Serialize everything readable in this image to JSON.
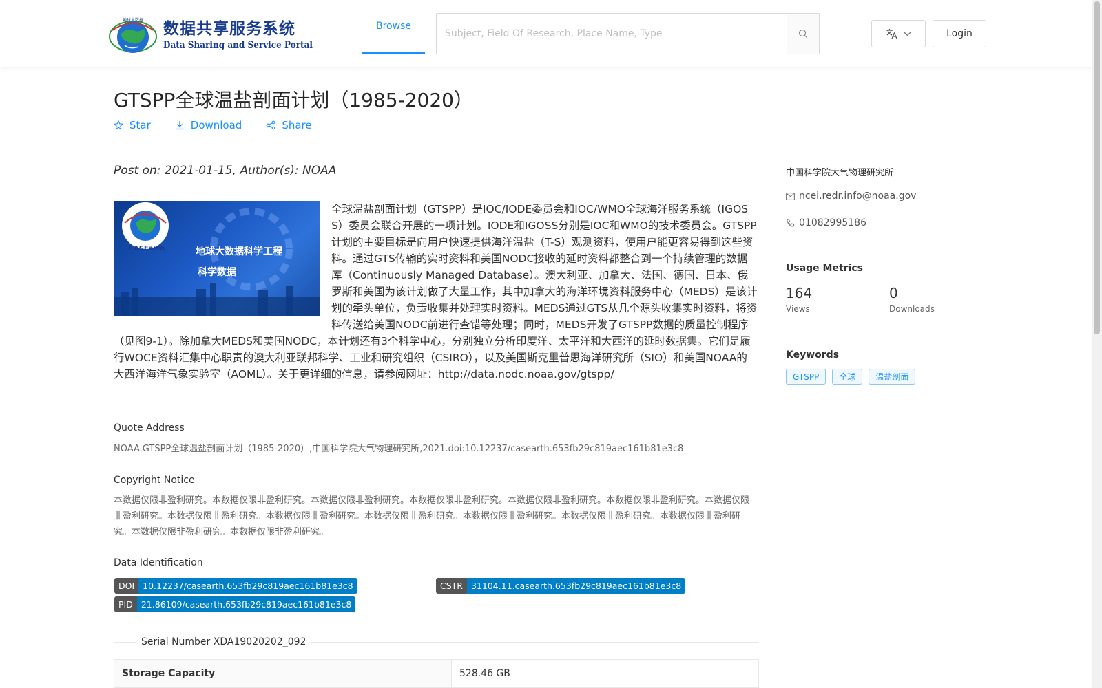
{
  "header": {
    "logo_cn": "数据共享服务系统",
    "logo_en": "Data Sharing and Service Portal",
    "nav_browse": "Browse",
    "search_placeholder": "Subject, Field Of Research, Place Name, Type",
    "login_label": "Login"
  },
  "dataset": {
    "title": "GTSPP全球温盐剖面计划（1985-2020）",
    "actions": {
      "star": "Star",
      "download": "Download",
      "share": "Share"
    },
    "posted": "Post on: 2021-01-15, Author(s): NOAA",
    "image_caption_line1": "地球大数据科学工程",
    "image_caption_line2": "科学数据",
    "image_badge": "CASEarth",
    "description": "全球温盐剖面计划（GTSPP）是IOC/IODE委员会和IOC/WMO全球海洋服务系统（IGOSS）委员会联合开展的一项计划。IODE和IGOSS分别是IOC和WMO的技术委员会。GTSPP计划的主要目标是向用户快速提供海洋温盐（T-S）观测资料，使用户能更容易得到这些资料。通过GTS传输的实时资料和美国NODC接收的延时资料都整合到一个持续管理的数据库（Continuously Managed Database）。澳大利亚、加拿大、法国、德国、日本、俄罗斯和美国为该计划做了大量工作，其中加拿大的海洋环境资料服务中心（MEDS）是该计划的牵头单位，负责收集并处理实时资料。MEDS通过GTS从几个源头收集实时资料，将资料传送给美国NODC前进行查错等处理；同时，MEDS开发了GTSPP数据的质量控制程序（见图9-1）。除加拿大MEDS和美国NODC，本计划还有3个科学中心，分别独立分析印度洋、太平洋和大西洋的延时数据集。它们是履行WOCE资料汇集中心职责的澳大利亚联邦科学、工业和研究组织（CSIRO），以及美国斯克里普思海洋研究所（SIO）和美国NOAA的大西洋海洋气象实验室（AOML）。关于更详细的信息，请参阅网址：http://data.nodc.noaa.gov/gtspp/",
    "quote_label": "Quote Address",
    "quote_text": "NOAA.GTSPP全球温盐剖面计划（1985-2020）,中国科学院大气物理研究所,2021.doi:10.12237/casearth.653fb29c819aec161b81e3c8",
    "copyright_label": "Copyright Notice",
    "copyright_text": "本数据仅限非盈利研究。本数据仅限非盈利研究。本数据仅限非盈利研究。本数据仅限非盈利研究。本数据仅限非盈利研究。本数据仅限非盈利研究。本数据仅限非盈利研究。本数据仅限非盈利研究。本数据仅限非盈利研究。本数据仅限非盈利研究。本数据仅限非盈利研究。本数据仅限非盈利研究。本数据仅限非盈利研究。本数据仅限非盈利研究。本数据仅限非盈利研究。",
    "identification_label": "Data Identification",
    "identifiers": {
      "doi": {
        "key": "DOI",
        "value": "10.12237/casearth.653fb29c819aec161b81e3c8"
      },
      "cstr": {
        "key": "CSTR",
        "value": "31104.11.casearth.653fb29c819aec161b81e3c8"
      },
      "pid": {
        "key": "PID",
        "value": "21.86109/casearth.653fb29c819aec161b81e3c8"
      }
    },
    "serial_number": "Serial Number XDA19020202_092",
    "storage_label": "Storage Capacity",
    "storage_value": "528.46 GB"
  },
  "sidebar": {
    "organization": "中国科学院大气物理研究所",
    "email": "ncei.redr.info@noaa.gov",
    "phone": "01082995186",
    "metrics_title": "Usage Metrics",
    "views_count": "164",
    "views_label": "Views",
    "downloads_count": "0",
    "downloads_label": "Downloads",
    "keywords_title": "Keywords",
    "keywords": [
      "GTSPP",
      "全球",
      "温盐剖面"
    ]
  },
  "colors": {
    "accent": "#1890ff",
    "id_key_bg": "#555555",
    "id_value_bg": "#007ec6",
    "logo_blue": "#1a3c8c"
  }
}
